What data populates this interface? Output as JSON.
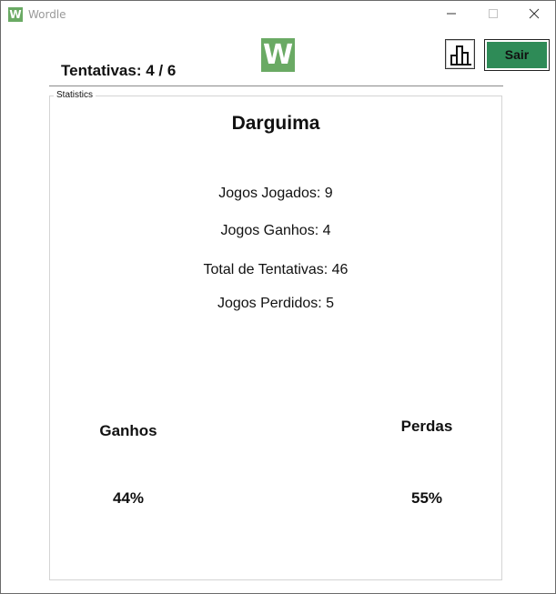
{
  "window": {
    "title": "Wordle",
    "icon_letter": "W"
  },
  "header": {
    "attempts_text": "Tentativas: 4 / 6",
    "logo_letter": "W",
    "stats_icon": "bar-chart-icon",
    "exit_label": "Sair"
  },
  "statistics": {
    "group_label": "Statistics",
    "player_name": "Darguima",
    "games_played": "Jogos Jogados: 9",
    "games_won": "Jogos Ganhos: 4",
    "total_attempts": "Total de Tentativas: 46",
    "games_lost": "Jogos Perdidos: 5",
    "wins_label": "Ganhos",
    "wins_percent": "44%",
    "losses_label": "Perdas",
    "losses_percent": "55%"
  },
  "colors": {
    "logo_green": "#6aaa64",
    "exit_button_green": "#2e8b57"
  }
}
